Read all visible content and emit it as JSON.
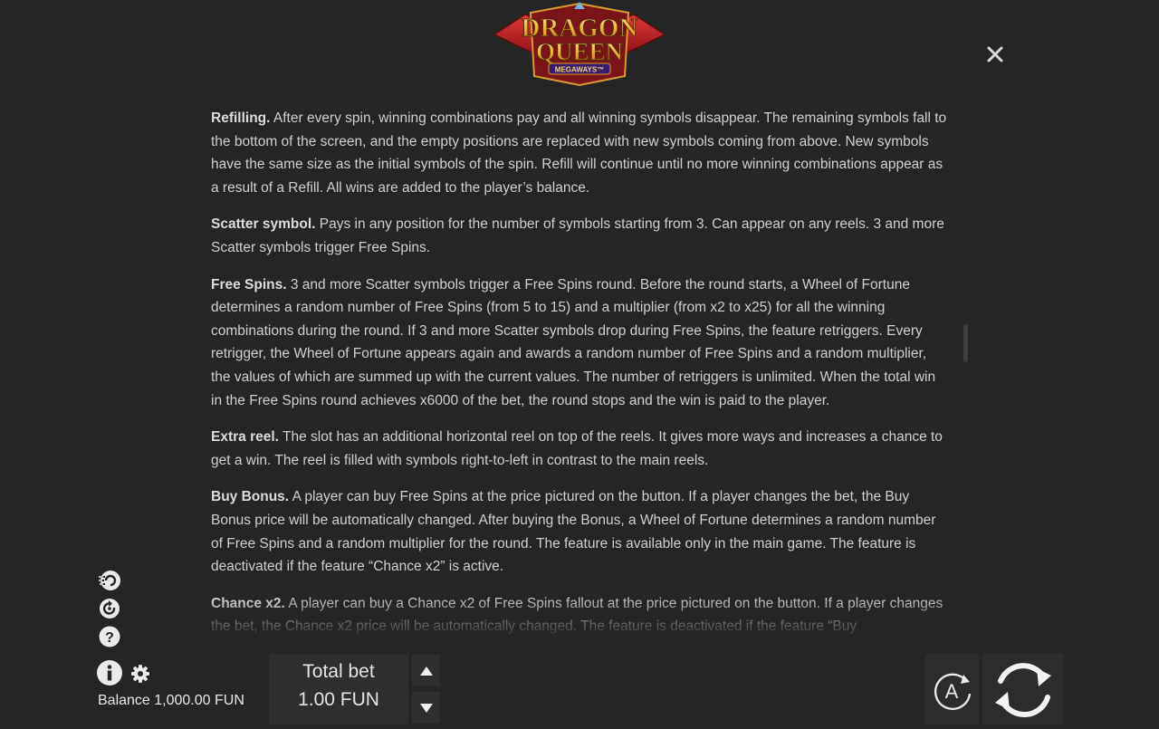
{
  "logo": {
    "line1": "DRAGON",
    "line2": "QUEEN",
    "line3": "MEGAWAYS™"
  },
  "rules": [
    {
      "title": "Refilling.",
      "text": "After every spin, winning combinations pay and all winning symbols disappear. The remaining symbols fall to the bottom of the screen, and the empty positions are replaced with new symbols coming from above. New symbols have the same size as the initial symbols of the spin. Refill will continue until no more winning combinations appear as a result of a Refill. All wins are added to the player’s balance."
    },
    {
      "title": "Scatter symbol.",
      "text": "Pays in any position for the number of symbols starting from 3. Can appear on any reels. 3 and more Scatter symbols trigger Free Spins."
    },
    {
      "title": "Free Spins.",
      "text": "3 and more Scatter symbols trigger a Free Spins round. Before the round starts, a Wheel of Fortune determines a random number of Free Spins (from 5 to 15) and a multiplier (from x2 to x25) for all the winning combinations during the round. If 3 and more Scatter symbols drop during Free Spins, the feature retriggers. Every retrigger, the Wheel of Fortune appears again and awards a random number of Free Spins and a random multiplier, the values of which are summed up with the current values. The number of retriggers is unlimited. When the total win in the Free Spins round achieves x6000 of the bet, the round stops and the win is paid to the player."
    },
    {
      "title": "Extra reel.",
      "text": "The slot has an additional horizontal reel on top of the reels. It gives more ways and increases a chance to get a win. The reel is filled with symbols right-to-left in contrast to the main reels."
    },
    {
      "title": "Buy Bonus.",
      "text": "A player can buy Free Spins at the price pictured on the button. If a player changes the bet, the Buy Bonus price will be automatically changed. After buying the Bonus, a Wheel of Fortune determines a random number of Free Spins and a random multiplier for the round. The feature is available only in the main game. The feature is deactivated if the feature “Chance x2” is active."
    },
    {
      "title": "Chance x2.",
      "text": "A player can buy a Chance x2 of Free Spins fallout at the price pictured on the button. If a player changes the bet, the Chance x2 price will be automatically changed. The feature is deactivated if the feature “Buy"
    }
  ],
  "footer": {
    "balance": "Balance 1,000.00 FUN",
    "bet_label": "Total bet",
    "bet_value": "1.00 FUN",
    "auto_label": "A"
  },
  "icons": {
    "close": "close-icon",
    "turbo": "turbo-spin-icon",
    "history": "history-icon",
    "help": "help-icon",
    "info": "info-icon",
    "settings": "gear-icon",
    "bet_up": "arrow-up-icon",
    "bet_down": "arrow-down-icon",
    "autoplay": "autoplay-icon",
    "spin": "spin-icon"
  },
  "colors": {
    "background": "#252525",
    "text": "#cfcfcf",
    "logo_red": "#c8242c",
    "logo_gold": "#f0b63a"
  }
}
